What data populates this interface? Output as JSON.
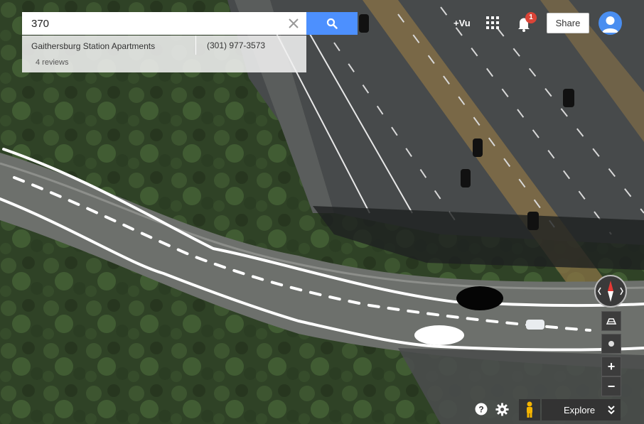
{
  "search": {
    "query": "370"
  },
  "result": {
    "name": "Gaithersburg Station Apartments",
    "phone": "(301) 977-3573",
    "reviews": "4 reviews"
  },
  "header": {
    "user": "+Vu",
    "notification_count": "1",
    "share_label": "Share"
  },
  "bottom_bar": {
    "explore_label": "Explore"
  },
  "icons": {
    "search": "search-icon",
    "clear": "close-icon",
    "apps": "apps-grid-icon",
    "notifications": "bell-icon",
    "account": "avatar-icon",
    "compass": "compass-icon",
    "tilt": "tilt-icon",
    "location": "my-location-icon",
    "zoom_in": "plus-icon",
    "zoom_out": "minus-icon",
    "help": "help-icon",
    "settings": "gear-icon",
    "street_view": "pegman-icon",
    "expand": "double-chevron-down-icon"
  },
  "colors": {
    "search_button": "#4d90fe",
    "notification_badge": "#db4437",
    "avatar": "#4a8ef0",
    "compass_north": "#e53935"
  }
}
